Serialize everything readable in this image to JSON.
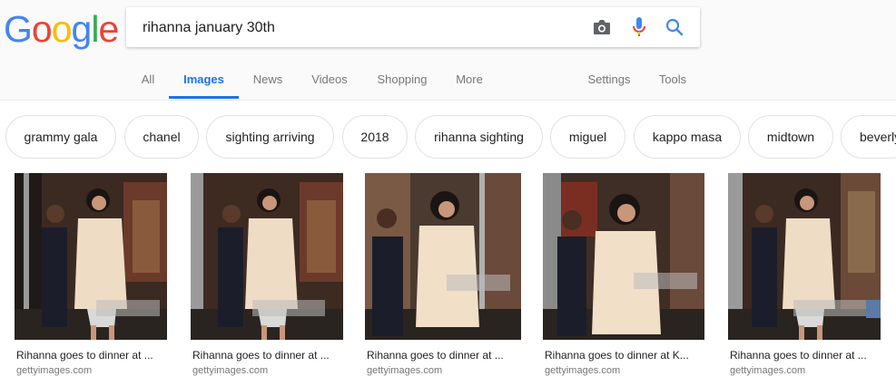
{
  "logo": {
    "letters": [
      "G",
      "o",
      "o",
      "g",
      "l",
      "e"
    ],
    "colors": [
      "#4285f4",
      "#ea4335",
      "#fbbc05",
      "#4285f4",
      "#34a853",
      "#ea4335"
    ]
  },
  "search": {
    "query": "rihanna january 30th",
    "camera_icon": "camera-icon",
    "mic_icon": "microphone-icon",
    "search_icon": "search-icon"
  },
  "tabs": {
    "all": "All",
    "images": "Images",
    "news": "News",
    "videos": "Videos",
    "shopping": "Shopping",
    "more": "More",
    "settings": "Settings",
    "tools": "Tools",
    "active": "Images",
    "accent": "#1a73e8"
  },
  "chips": [
    "grammy gala",
    "chanel",
    "sighting arriving",
    "2018",
    "rihanna sighting",
    "miguel",
    "kappo masa",
    "midtown",
    "beverly"
  ],
  "results": [
    {
      "caption": "Rihanna goes to dinner at ...",
      "source": "gettyimages.com"
    },
    {
      "caption": "Rihanna goes to dinner at ...",
      "source": "gettyimages.com"
    },
    {
      "caption": "Rihanna goes to dinner at ...",
      "source": "gettyimages.com"
    },
    {
      "caption": "Rihanna goes to dinner at K...",
      "source": "gettyimages.com"
    },
    {
      "caption": "Rihanna goes to dinner at ...",
      "source": "gettyimages.com"
    }
  ]
}
